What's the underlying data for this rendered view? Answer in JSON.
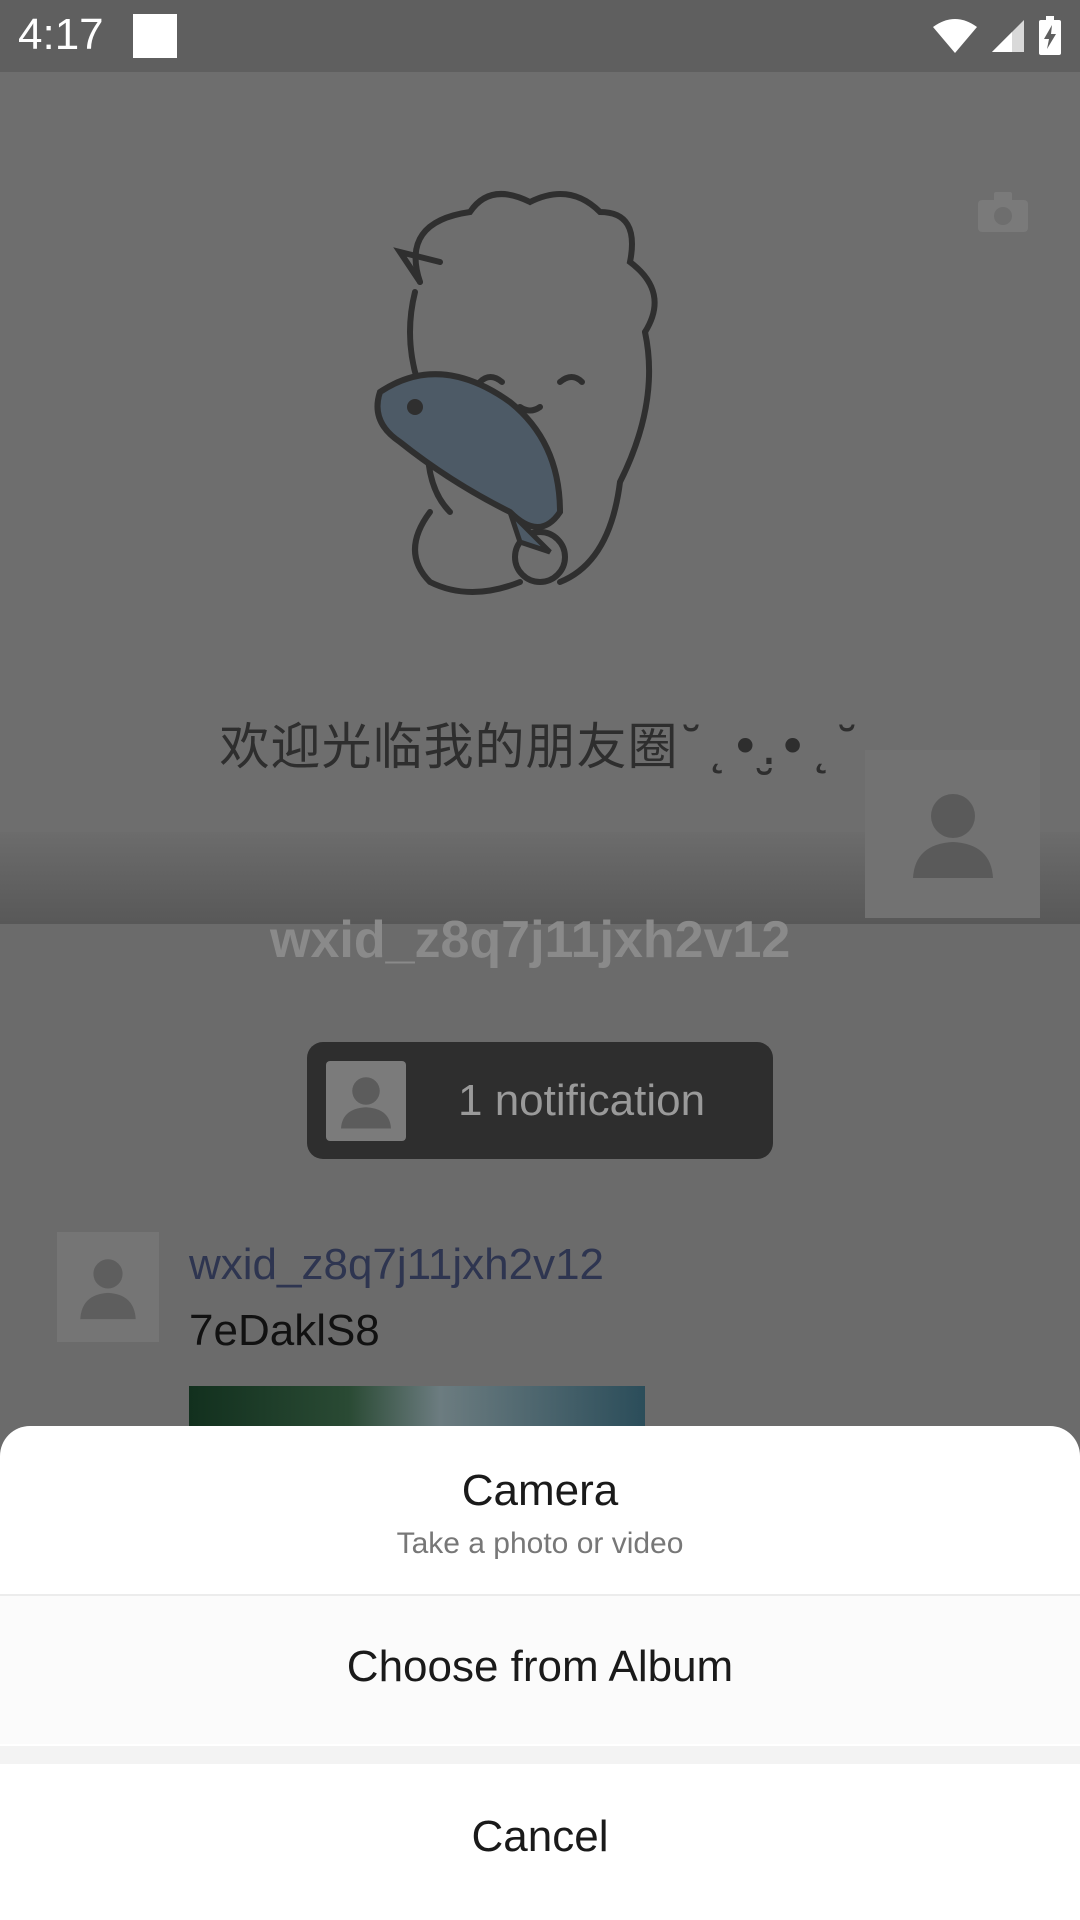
{
  "status_bar": {
    "time": "4:17",
    "icons": [
      "wifi-icon",
      "signal-icon",
      "battery-charging-icon"
    ]
  },
  "cover": {
    "caption": "欢迎光临我的朋友圈˘˛•.̮•˛˘",
    "username": "wxid_z8q7j11jxh2v12"
  },
  "notification": {
    "text": "1 notification"
  },
  "feed": {
    "items": [
      {
        "name": "wxid_z8q7j11jxh2v12",
        "text": "7eDaklS8"
      }
    ]
  },
  "sheet": {
    "camera_title": "Camera",
    "camera_subtitle": "Take a photo or video",
    "album_label": "Choose from Album",
    "cancel_label": "Cancel"
  }
}
